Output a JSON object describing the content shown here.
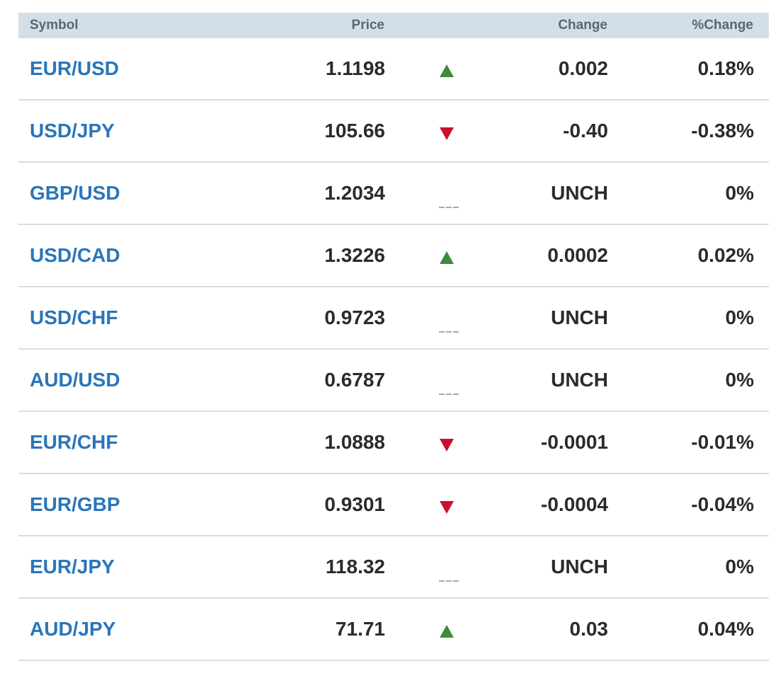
{
  "headers": {
    "symbol": "Symbol",
    "price": "Price",
    "change": "Change",
    "pct_change": "%Change"
  },
  "colors": {
    "up": "#3d8b3d",
    "down": "#c8102e",
    "flat": "#a9a9a9",
    "link": "#2a75ba",
    "header_bg": "#d3dfe8"
  },
  "rows": [
    {
      "symbol": "EUR/USD",
      "price": "1.1198",
      "direction": "up",
      "change": "0.002",
      "pct_change": "0.18%"
    },
    {
      "symbol": "USD/JPY",
      "price": "105.66",
      "direction": "down",
      "change": "-0.40",
      "pct_change": "-0.38%"
    },
    {
      "symbol": "GBP/USD",
      "price": "1.2034",
      "direction": "flat",
      "change": "UNCH",
      "pct_change": "0%"
    },
    {
      "symbol": "USD/CAD",
      "price": "1.3226",
      "direction": "up",
      "change": "0.0002",
      "pct_change": "0.02%"
    },
    {
      "symbol": "USD/CHF",
      "price": "0.9723",
      "direction": "flat",
      "change": "UNCH",
      "pct_change": "0%"
    },
    {
      "symbol": "AUD/USD",
      "price": "0.6787",
      "direction": "flat",
      "change": "UNCH",
      "pct_change": "0%"
    },
    {
      "symbol": "EUR/CHF",
      "price": "1.0888",
      "direction": "down",
      "change": "-0.0001",
      "pct_change": "-0.01%"
    },
    {
      "symbol": "EUR/GBP",
      "price": "0.9301",
      "direction": "down",
      "change": "-0.0004",
      "pct_change": "-0.04%"
    },
    {
      "symbol": "EUR/JPY",
      "price": "118.32",
      "direction": "flat",
      "change": "UNCH",
      "pct_change": "0%"
    },
    {
      "symbol": "AUD/JPY",
      "price": "71.71",
      "direction": "up",
      "change": "0.03",
      "pct_change": "0.04%"
    }
  ]
}
